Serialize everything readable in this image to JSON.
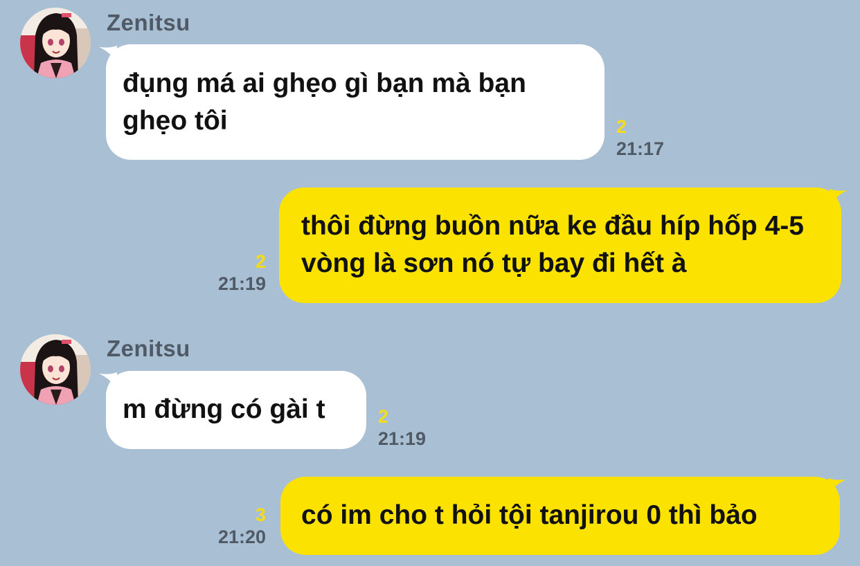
{
  "messages": [
    {
      "direction": "in",
      "sender": "Zenitsu",
      "text": "đụng má ai ghẹo gì bạn mà bạn ghẹo tôi",
      "read_count": "2",
      "time": "21:17"
    },
    {
      "direction": "out",
      "text": "thôi đừng buồn nữa ke đầu híp hốp 4-5 vòng là sơn nó tự bay đi hết à",
      "read_count": "2",
      "time": "21:19"
    },
    {
      "direction": "in",
      "sender": "Zenitsu",
      "text": "m đừng có gài t",
      "read_count": "2",
      "time": "21:19"
    },
    {
      "direction": "out",
      "text": "có im cho t hỏi tội tanjirou 0 thì bảo",
      "read_count": "3",
      "time": "21:20"
    }
  ],
  "colors": {
    "background": "#a9bfd3",
    "incoming_bubble": "#ffffff",
    "outgoing_bubble": "#fbe200",
    "read_count": "#f5dc18",
    "meta_text": "#4f5a66"
  },
  "icons": {
    "avatar": "anime-girl-avatar-icon"
  }
}
